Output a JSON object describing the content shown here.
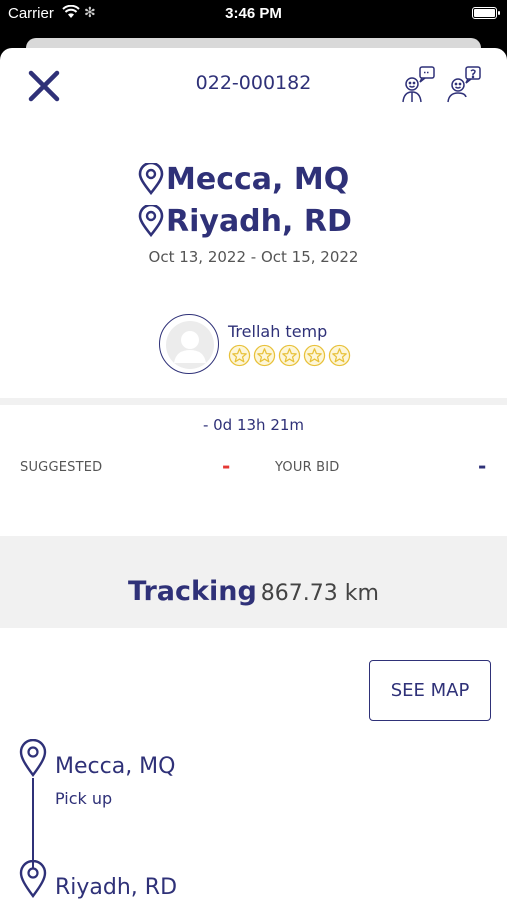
{
  "status_bar": {
    "carrier": "Carrier",
    "time": "3:46 PM"
  },
  "header": {
    "load_id": "022-000182"
  },
  "route": {
    "origin": "Mecca, MQ",
    "destination": "Riyadh, RD",
    "date_range": "Oct 13, 2022 - Oct 15, 2022"
  },
  "carrier": {
    "name": "Trellah temp",
    "rating_stars": 5
  },
  "bidding": {
    "countdown": "- 0d 13h 21m",
    "suggested_label": "SUGGESTED",
    "suggested_value": "-",
    "your_bid_label": "YOUR BID",
    "your_bid_value": "-"
  },
  "tracking": {
    "label": "Tracking",
    "distance": "867.73 km"
  },
  "actions": {
    "see_map": "SEE MAP"
  },
  "stops": [
    {
      "city": "Mecca, MQ",
      "type": "Pick up"
    },
    {
      "city": "Riyadh, RD"
    }
  ],
  "colors": {
    "primary": "#2f3178",
    "suggested": "#e53935",
    "star": "#e8c13a"
  }
}
